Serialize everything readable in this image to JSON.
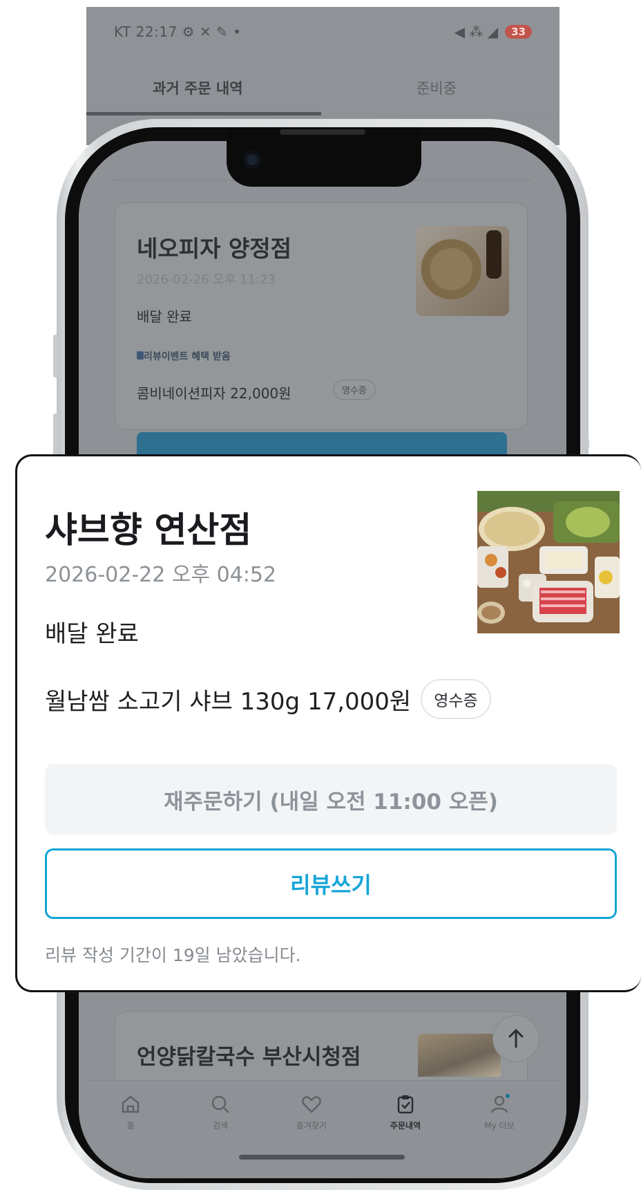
{
  "status_bar": {
    "left": "KT 22:17 ⚙ ✕ ✎ •",
    "right_icons": "◀ ⁂ ◢",
    "battery": "33"
  },
  "tabs": [
    {
      "label": "과거 주문 내역",
      "active": true
    },
    {
      "label": "준비중",
      "active": false
    }
  ],
  "background_orders": [
    {
      "store": "네오피자 양정점",
      "date": "2026-02-26 오후 11:23",
      "status": "배달 완료",
      "event": "리뷰이벤트 혜택 받음",
      "menu": "콤비네이션피자 22,000원",
      "receipt": "영수증"
    },
    {
      "store": "언양닭칼국수 부산시청점"
    }
  ],
  "focused_order": {
    "store": "샤브향 연산점",
    "date": "2026-02-22 오후 04:52",
    "status": "배달 완료",
    "menu": "월남쌈 소고기 샤브 130g 17,000원",
    "receipt_label": "영수증",
    "reorder_label": "재주문하기 (내일 오전 11:00 오픈)",
    "review_label": "리뷰쓰기",
    "review_note": "리뷰 작성 기간이 19일 남았습니다."
  },
  "bottom_nav": [
    {
      "label": "홈",
      "icon": "home-icon"
    },
    {
      "label": "검색",
      "icon": "search-icon"
    },
    {
      "label": "즐겨찾기",
      "icon": "heart-icon"
    },
    {
      "label": "주문내역",
      "icon": "order-list-icon",
      "active": true
    },
    {
      "label": "My 더보",
      "icon": "profile-icon"
    }
  ],
  "colors": {
    "accent": "#17a5d8",
    "reorder_bg": "#f2f4f6",
    "text_primary": "#191b1e",
    "text_secondary": "#8c9196"
  }
}
